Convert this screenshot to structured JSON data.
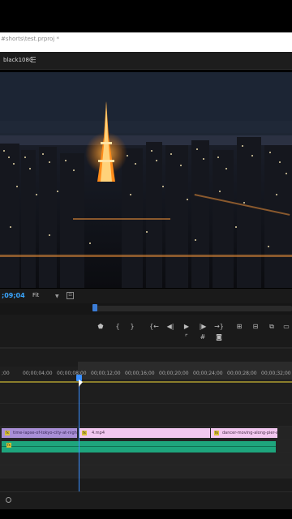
{
  "app": {
    "project_title": "#shorts\\test.prproj *"
  },
  "program_monitor": {
    "sequence_tab": "black1080",
    "timecode": ";09;04",
    "fit_label": "Fit",
    "playback_progress_fraction": 0.0
  },
  "transport": {
    "buttons": [
      "marker",
      "in-point",
      "out-point",
      "go-to-in",
      "step-back",
      "play",
      "step-forward",
      "go-to-out",
      "insert",
      "overwrite",
      "export-frame"
    ]
  },
  "timeline": {
    "ruler_labels": [
      ";00",
      "00;00;04;00",
      "00;00;08;00",
      "00;00;12;00",
      "00;00;16;00",
      "00;00;20;00",
      "00;00;24;00",
      "00;00;28;00",
      "00;00;32;00"
    ],
    "video_clips": [
      {
        "label": "time-lapse-of-tokyo-city-at-nigh",
        "color": "#a98fd6"
      },
      {
        "label": "4.mp4",
        "color": "#f2c7f0"
      },
      {
        "label": "dancer-moving-along-pier-a",
        "color": "#f2c7f0"
      }
    ],
    "fx_badge": "fx",
    "audio_clip_color": "#1ea57d"
  },
  "colors": {
    "accent": "#3a8fff",
    "timecode": "#3aa6ff",
    "panel": "#1a1a1a"
  }
}
